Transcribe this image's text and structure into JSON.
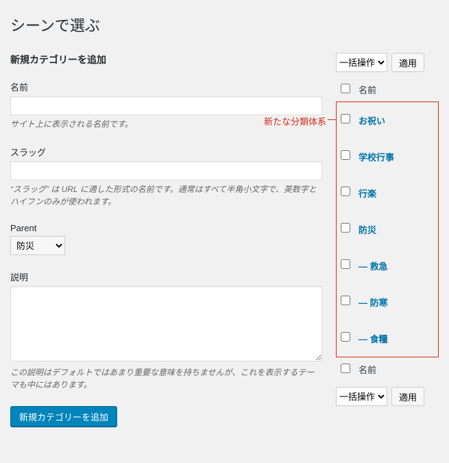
{
  "page_title": "シーンで選ぶ",
  "form": {
    "heading": "新規カテゴリーを追加",
    "name": {
      "label": "名前",
      "value": "",
      "desc": "サイト上に表示される名前です。"
    },
    "slug": {
      "label": "スラッグ",
      "value": "",
      "desc": "“スラッグ” は URL に適した形式の名前です。通常はすべて半角小文字で、英数字とハイフンのみが使われます。"
    },
    "parent": {
      "label": "Parent",
      "selected": "防災"
    },
    "description": {
      "label": "説明",
      "value": "",
      "desc": "この説明はデフォルトではあまり重要な意味を持ちませんが、これを表示するテーマも中にはあります。"
    },
    "submit": "新規カテゴリーを追加"
  },
  "annotation": "新たな分類体系",
  "bulk": {
    "selected": "一括操作",
    "apply": "適用"
  },
  "col_name": "名前",
  "categories": [
    {
      "label": "お祝い"
    },
    {
      "label": "学校行事"
    },
    {
      "label": "行楽"
    },
    {
      "label": "防災"
    },
    {
      "label": "— 救急"
    },
    {
      "label": "— 防寒"
    },
    {
      "label": "— 食糧"
    }
  ]
}
